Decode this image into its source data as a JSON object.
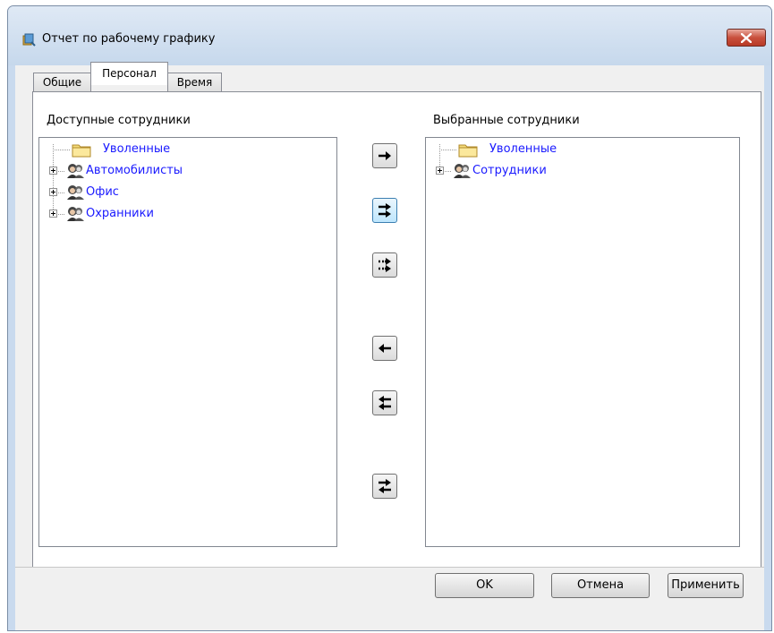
{
  "window": {
    "title": "Отчет по рабочему графику"
  },
  "tabs": [
    {
      "label": "Общие"
    },
    {
      "label": "Персонал"
    },
    {
      "label": "Время"
    }
  ],
  "available": {
    "label": "Доступные сотрудники",
    "items": [
      {
        "label": "Уволенные",
        "icon": "folder-icon",
        "expandable": false
      },
      {
        "label": "Автомобилисты",
        "icon": "group-icon",
        "expandable": true
      },
      {
        "label": "Офис",
        "icon": "group-icon",
        "expandable": true
      },
      {
        "label": "Охранники",
        "icon": "group-icon",
        "expandable": true
      }
    ]
  },
  "selected": {
    "label": "Выбранные сотрудники",
    "items": [
      {
        "label": "Уволенные",
        "icon": "folder-icon",
        "expandable": false
      },
      {
        "label": "Сотрудники",
        "icon": "group-icon",
        "expandable": true
      }
    ]
  },
  "transfer_buttons": [
    {
      "name": "move-right-icon"
    },
    {
      "name": "move-all-right-icon"
    },
    {
      "name": "move-group-right-icon"
    },
    {
      "name": "move-left-icon"
    },
    {
      "name": "move-all-left-icon"
    },
    {
      "name": "swap-icon"
    }
  ],
  "footer": {
    "ok_label": "OK",
    "cancel_label": "Отмена",
    "apply_label": "Применить"
  },
  "colors": {
    "tree_text": "#1a1aff",
    "title_bar": "#c6d8ec",
    "close_button": "#c9503d"
  }
}
